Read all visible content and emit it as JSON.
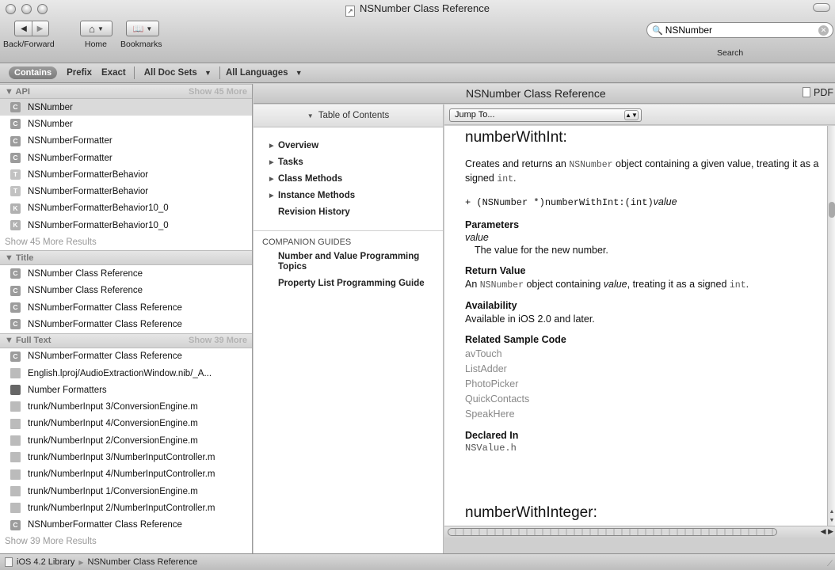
{
  "window": {
    "title": "NSNumber Class Reference"
  },
  "toolbar": {
    "back_forward_label": "Back/Forward",
    "home_label": "Home",
    "bookmarks_label": "Bookmarks",
    "search_value": "NSNumber",
    "search_label": "Search"
  },
  "scope_bar": {
    "contains": "Contains",
    "prefix": "Prefix",
    "exact": "Exact",
    "doc_sets": "All Doc Sets",
    "languages": "All Languages"
  },
  "sidebar": {
    "api": {
      "title": "API",
      "show_more": "Show 45 More",
      "items": [
        {
          "badge": "C",
          "label": "NSNumber"
        },
        {
          "badge": "C",
          "label": "NSNumber"
        },
        {
          "badge": "C",
          "label": "NSNumberFormatter"
        },
        {
          "badge": "C",
          "label": "NSNumberFormatter"
        },
        {
          "badge": "T",
          "label": "NSNumberFormatterBehavior"
        },
        {
          "badge": "T",
          "label": "NSNumberFormatterBehavior"
        },
        {
          "badge": "K",
          "label": "NSNumberFormatterBehavior10_0"
        },
        {
          "badge": "K",
          "label": "NSNumberFormatterBehavior10_0"
        }
      ],
      "more_results": "Show 45 More Results"
    },
    "title_group": {
      "title": "Title",
      "items": [
        {
          "badge": "C",
          "label": "NSNumber Class Reference"
        },
        {
          "badge": "C",
          "label": "NSNumber Class Reference"
        },
        {
          "badge": "C",
          "label": "NSNumberFormatter Class Reference"
        },
        {
          "badge": "C",
          "label": "NSNumberFormatter Class Reference"
        }
      ]
    },
    "full_text": {
      "title": "Full Text",
      "show_more": "Show 39 More",
      "items": [
        {
          "badge": "C",
          "label": "NSNumberFormatter Class Reference"
        },
        {
          "badge": "F",
          "label": "English.lproj/AudioExtractionWindow.nib/_A..."
        },
        {
          "badge": "B",
          "label": "Number Formatters"
        },
        {
          "badge": "F",
          "label": "trunk/NumberInput 3/ConversionEngine.m"
        },
        {
          "badge": "F",
          "label": "trunk/NumberInput 4/ConversionEngine.m"
        },
        {
          "badge": "F",
          "label": "trunk/NumberInput 2/ConversionEngine.m"
        },
        {
          "badge": "F",
          "label": "trunk/NumberInput 3/NumberInputController.m"
        },
        {
          "badge": "F",
          "label": "trunk/NumberInput 4/NumberInputController.m"
        },
        {
          "badge": "F",
          "label": "trunk/NumberInput 1/ConversionEngine.m"
        },
        {
          "badge": "F",
          "label": "trunk/NumberInput 2/NumberInputController.m"
        },
        {
          "badge": "C",
          "label": "NSNumberFormatter Class Reference"
        }
      ],
      "more_results": "Show 39 More Results"
    }
  },
  "doc": {
    "title": "NSNumber Class Reference",
    "pdf_label": "PDF",
    "toc_header": "Table of Contents",
    "toc": [
      "Overview",
      "Tasks",
      "Class Methods",
      "Instance Methods"
    ],
    "revision_history": "Revision History",
    "companion_header": "COMPANION GUIDES",
    "companion": [
      "Number and Value Programming Topics",
      "Property List Programming Guide"
    ],
    "jump_to": "Jump To...",
    "method_title": "numberWithInt:",
    "desc_1": "Creates and returns an ",
    "desc_code_1": "NSNumber",
    "desc_2": " object containing a given value, treating it as a signed ",
    "desc_code_2": "int",
    "desc_3": ".",
    "declaration": "+ (NSNumber *)numberWithInt:(int)",
    "declaration_param": "value",
    "parameters_label": "Parameters",
    "param_name": "value",
    "param_desc": "The value for the new number.",
    "return_label": "Return Value",
    "return_1": "An ",
    "return_code_1": "NSNumber",
    "return_2": " object containing ",
    "return_italic": "value",
    "return_3": ", treating it as a signed ",
    "return_code_2": "int",
    "return_4": ".",
    "availability_label": "Availability",
    "availability_text": "Available in iOS 2.0 and later.",
    "samples_label": "Related Sample Code",
    "samples": [
      "avTouch",
      "ListAdder",
      "PhotoPicker",
      "QuickContacts",
      "SpeakHere"
    ],
    "declared_label": "Declared In",
    "declared_file": "NSValue.h",
    "next_method_title": "numberWithInteger:"
  },
  "statusbar": {
    "library": "iOS 4.2 Library",
    "page": "NSNumber Class Reference"
  }
}
